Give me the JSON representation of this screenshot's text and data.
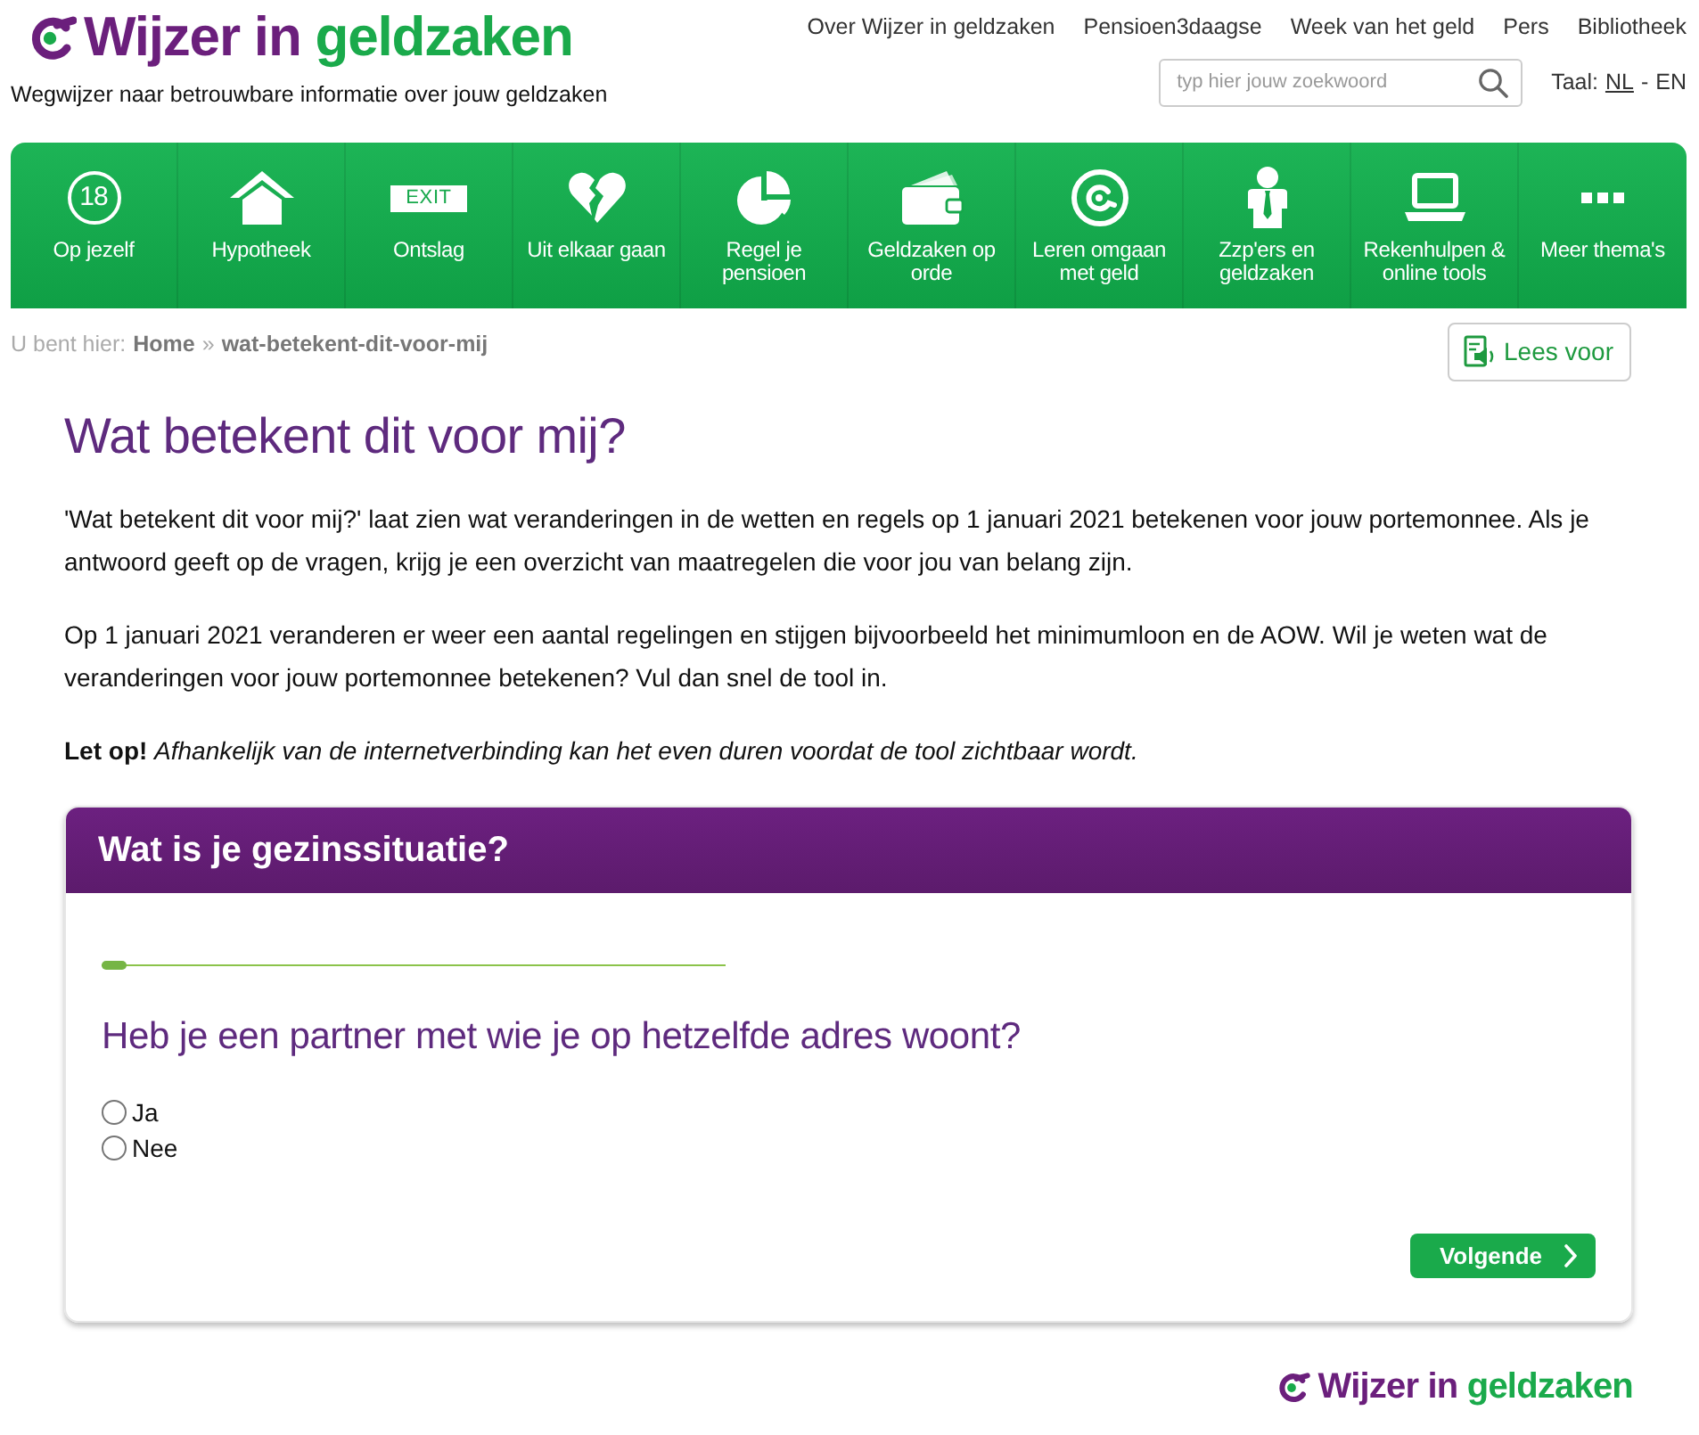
{
  "header": {
    "logo": {
      "text_1": "Wijzer in",
      "text_2": "geldzaken"
    },
    "tagline": "Wegwijzer naar betrouwbare informatie over jouw geldzaken",
    "top_links": [
      "Over Wijzer in geldzaken",
      "Pensioen3daagse",
      "Week van het geld",
      "Pers",
      "Bibliotheek"
    ],
    "search": {
      "placeholder": "typ hier jouw zoekwoord"
    },
    "language": {
      "label": "Taal:",
      "separator": "-",
      "options": [
        {
          "label": "NL",
          "selected": true
        },
        {
          "label": "EN",
          "selected": false
        }
      ]
    }
  },
  "nav": [
    {
      "kind": "age",
      "icon_text": "18",
      "label": "Op jezelf"
    },
    {
      "kind": "house",
      "label": "Hypotheek"
    },
    {
      "kind": "exit",
      "icon_text": "EXIT",
      "label": "Ontslag"
    },
    {
      "kind": "broken-heart",
      "label": "Uit elkaar gaan"
    },
    {
      "kind": "pie",
      "label": "Regel je pensioen"
    },
    {
      "kind": "wallet",
      "label": "Geldzaken op orde"
    },
    {
      "kind": "target",
      "label": "Leren omgaan met geld"
    },
    {
      "kind": "person",
      "label": "Zzp'ers en geldzaken"
    },
    {
      "kind": "laptop",
      "label": "Rekenhulpen & online tools"
    },
    {
      "kind": "more",
      "label": "Meer thema's"
    }
  ],
  "breadcrumb": {
    "prefix": "U bent hier:",
    "separator": "»",
    "items": [
      "Home",
      "wat-betekent-dit-voor-mij"
    ]
  },
  "read_aloud": {
    "label": "Lees voor"
  },
  "title": "Wat betekent dit voor mij?",
  "paragraphs": [
    "'Wat betekent dit voor mij?' laat zien wat veranderingen in de wetten en regels op 1 januari 2021 betekenen voor jouw portemonnee. Als je antwoord geeft op de vragen, krijg je een overzicht van maatregelen die voor jou van belang zijn.",
    "Op 1 januari 2021 veranderen er weer een aantal regelingen en stijgen bijvoorbeeld het minimumloon en de AOW. Wil je weten wat de veranderingen voor jouw portemonnee betekenen? Vul dan snel de tool in.",
    "**Let op!** *Afhankelijk van de internetverbinding kan het even duren voordat de tool zichtbaar wordt.*"
  ],
  "card": {
    "title": "Wat is je gezinssituatie?",
    "progress": {
      "level": 0.04
    },
    "question": "Heb je een partner met wie je op hetzelfde adres woont?",
    "options": [
      {
        "label": "Ja",
        "selected": false
      },
      {
        "label": "Nee",
        "selected": false
      }
    ],
    "next_button": "Volgende"
  },
  "footer": {
    "logo": {
      "text_1": "Wijzer in",
      "text_2": "geldzaken"
    }
  }
}
